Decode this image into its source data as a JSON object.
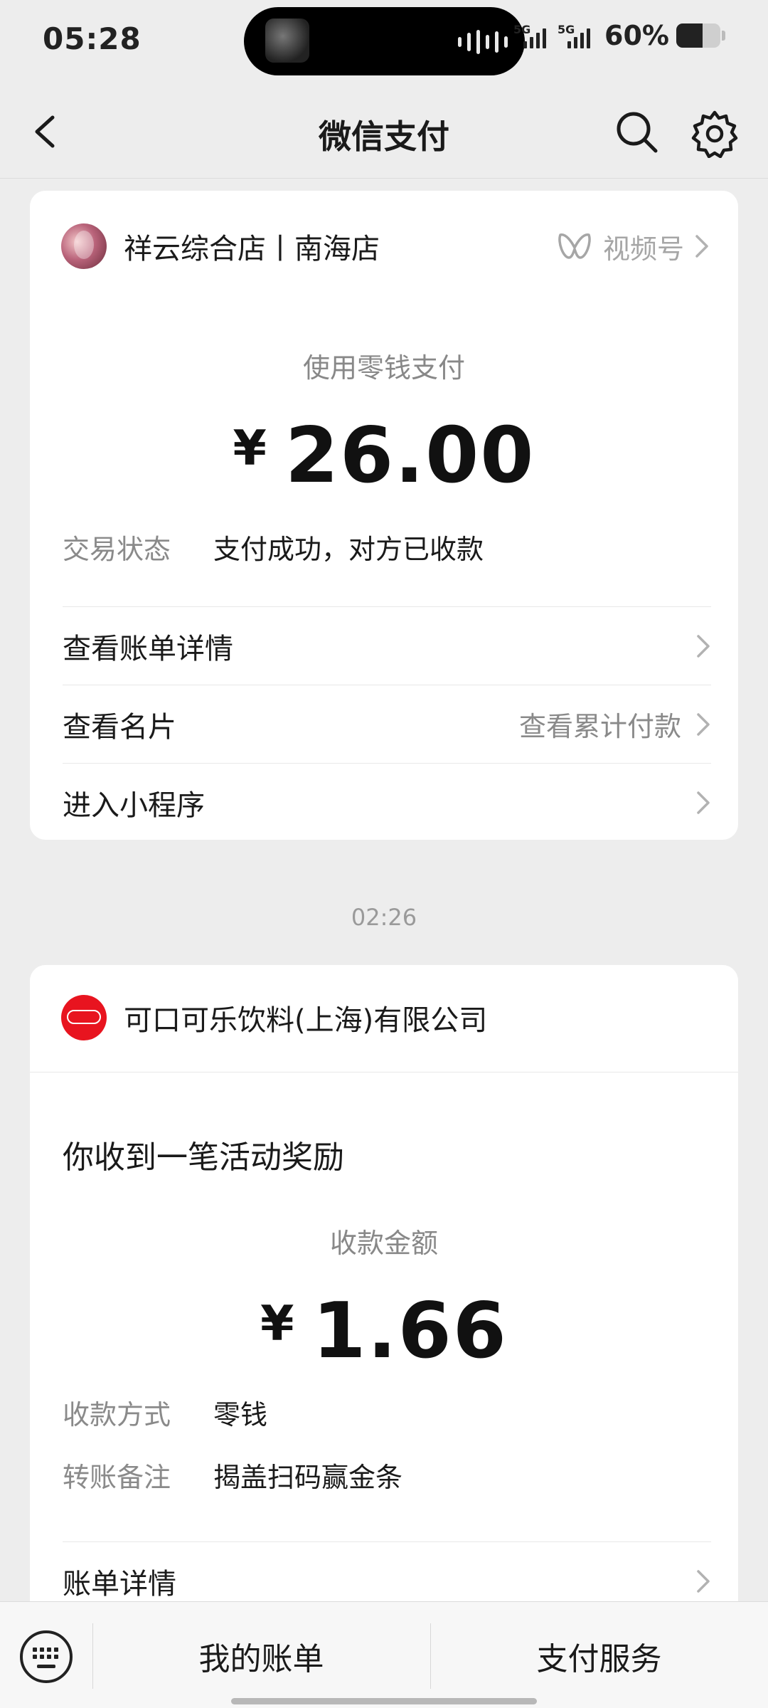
{
  "status_bar": {
    "time": "05:28",
    "network_1": "5G",
    "network_2": "5G",
    "battery_percent": "60%",
    "battery_level": 0.6
  },
  "nav": {
    "title": "微信支付",
    "back_icon": "chevron-left-icon",
    "search_icon": "search-icon",
    "settings_icon": "gear-icon"
  },
  "payment_card": {
    "merchant_name": "祥云综合店丨南海店",
    "channels_label": "视频号",
    "pay_method": "使用零钱支付",
    "currency": "¥",
    "amount": "26.00",
    "status_label": "交易状态",
    "status_value": "支付成功，对方已收款",
    "rows": [
      {
        "label": "查看账单详情",
        "hint": ""
      },
      {
        "label": "查看名片",
        "hint": "查看累计付款"
      },
      {
        "label": "进入小程序",
        "hint": ""
      }
    ]
  },
  "time_separator": "02:26",
  "reward_card": {
    "merchant_name": "可口可乐饮料(上海)有限公司",
    "title": "你收到一笔活动奖励",
    "amount_label": "收款金额",
    "currency": "¥",
    "amount": "1.66",
    "method_label": "收款方式",
    "method_value": "零钱",
    "note_label": "转账备注",
    "note_value": "揭盖扫码赢金条",
    "bill_details_label": "账单详情"
  },
  "bottom_bar": {
    "keyboard_icon": "keyboard-icon",
    "my_bills": "我的账单",
    "pay_services": "支付服务"
  },
  "colors": {
    "background": "#ededed",
    "card": "#ffffff",
    "coca_cola_red": "#e8141f",
    "secondary_text": "#8a8a8a"
  }
}
